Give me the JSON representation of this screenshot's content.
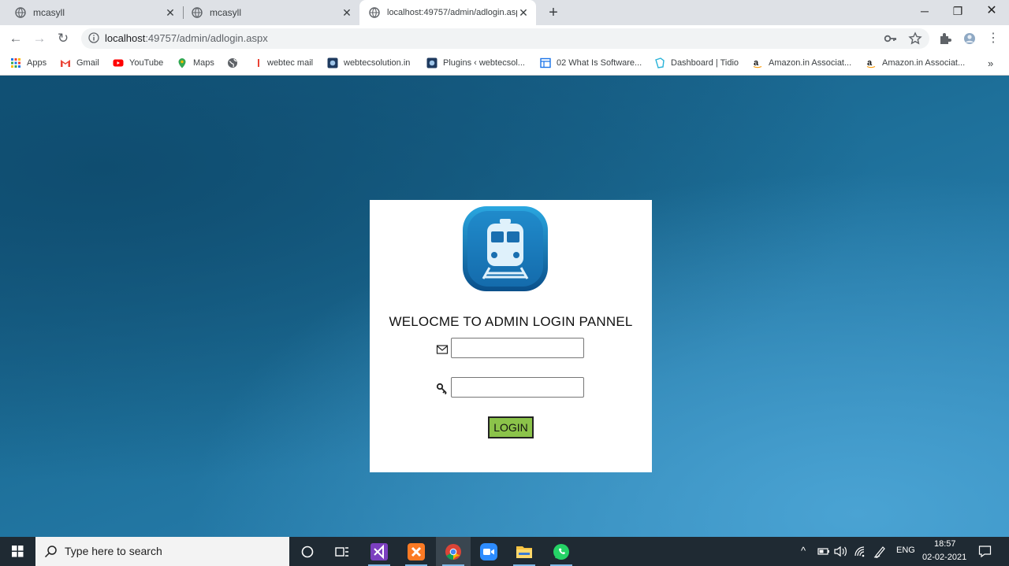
{
  "browser": {
    "tabs": [
      {
        "title": "mcasyll"
      },
      {
        "title": "mcasyll"
      },
      {
        "title": "localhost:49757/admin/adlogin.aspx"
      }
    ],
    "address": {
      "host": "localhost",
      "rest": ":49757/admin/adlogin.aspx"
    },
    "bookmarks": [
      {
        "label": "Apps",
        "icon": "apps-grid-icon"
      },
      {
        "label": "Gmail",
        "icon": "gmail-icon"
      },
      {
        "label": "YouTube",
        "icon": "youtube-icon"
      },
      {
        "label": "Maps",
        "icon": "maps-pin-icon"
      },
      {
        "label": "",
        "icon": "globe-icon"
      },
      {
        "label": "webtec mail",
        "icon": "mail-icon"
      },
      {
        "label": "webtecsolution.in",
        "icon": "site-icon"
      },
      {
        "label": "Plugins ‹ webtecsol...",
        "icon": "site-icon"
      },
      {
        "label": "02 What Is Software...",
        "icon": "doc-icon"
      },
      {
        "label": "Dashboard | Tidio",
        "icon": "tidio-icon"
      },
      {
        "label": "Amazon.in Associat...",
        "icon": "amazon-icon"
      },
      {
        "label": "Amazon.in Associat...",
        "icon": "amazon-icon"
      }
    ],
    "overflow": "»"
  },
  "login": {
    "heading": "WELOCME TO ADMIN LOGIN PANNEL",
    "button": "LOGIN",
    "email_value": "",
    "password_value": "",
    "accent": "#8bc34a"
  },
  "taskbar": {
    "search_placeholder": "Type here to search",
    "lang": "ENG",
    "time": "18:57",
    "date": "02-02-2021"
  }
}
